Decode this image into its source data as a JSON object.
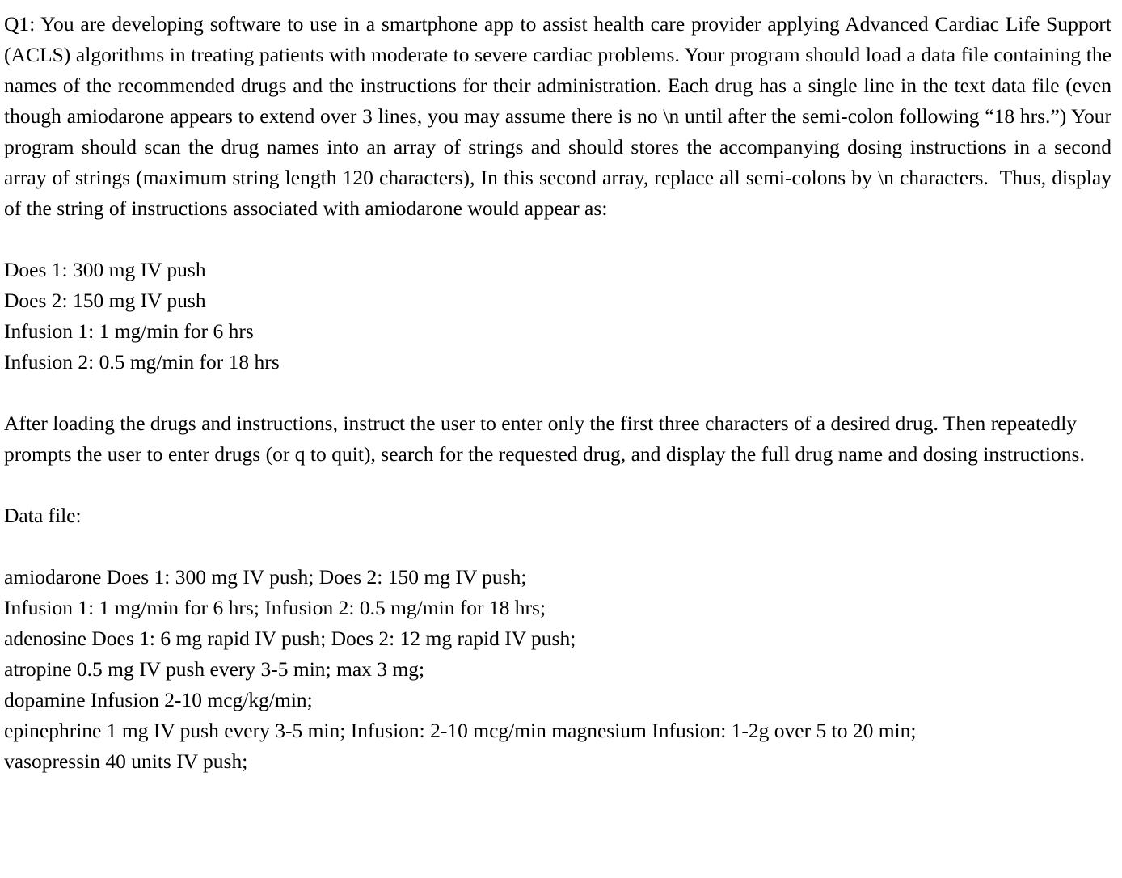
{
  "document": {
    "intro_paragraph": "Q1: You are developing software to use in a smartphone app to assist health care provider applying Advanced Cardiac Life Support (ACLS) algorithms in treating patients with moderate to severe cardiac problems. Your program should load a data file containing the names of the recommended drugs and the instructions for their administration. Each drug has a single line in the text data file (even though amiodarone appears to extend over 3 lines, you may assume there is no \\n until after the semi-colon following “18 hrs.”) Your program should scan the drug names into an array of strings and should stores the accompanying dosing instructions in a second array of strings (maximum string length 120 characters), In this second array, replace all semi-colons by \\n characters.  Thus, display of the string of instructions associated with amiodarone would appear as:",
    "sample_output_lines": [
      "Does 1: 300 mg IV push",
      "Does 2: 150 mg IV push",
      "Infusion 1: 1 mg/min for 6 hrs",
      "Infusion 2: 0.5 mg/min for 18 hrs"
    ],
    "instructions_paragraph": "After loading the drugs and instructions, instruct the user to enter only the first three characters of a desired drug. Then repeatedly prompts the user to enter drugs (or q to quit), search for the requested drug, and display the full drug name and dosing instructions.",
    "data_file_label": "Data file:",
    "data_file_lines": [
      "amiodarone Does 1: 300 mg IV push; Does 2: 150 mg IV push;",
      "Infusion 1: 1 mg/min for 6 hrs; Infusion 2: 0.5 mg/min for 18 hrs;",
      "adenosine Does 1: 6 mg rapid IV push; Does 2: 12 mg rapid IV push;",
      "atropine 0.5 mg IV push every 3-5 min; max 3 mg;",
      "dopamine Infusion 2-10 mcg/kg/min;",
      "epinephrine 1 mg IV push every 3-5 min; Infusion: 2-10 mcg/min magnesium Infusion: 1-2g over 5 to 20 min;",
      "vasopressin 40 units IV push;"
    ]
  }
}
